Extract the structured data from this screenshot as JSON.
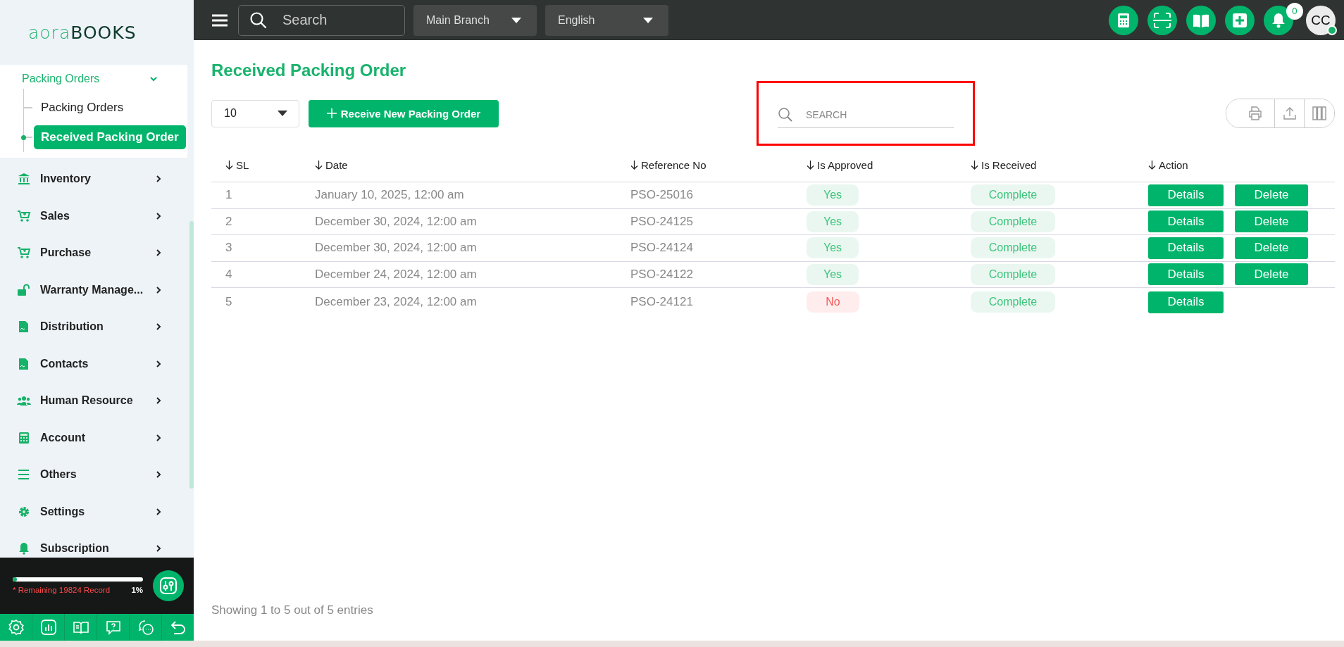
{
  "sidebar": {
    "logo": {
      "part_1": "aora",
      "part_2": "BOOKS"
    },
    "open_group": {
      "label": "Packing Orders",
      "expanded": true,
      "children": [
        {
          "label": "Packing Orders",
          "selected": false
        },
        {
          "label": "Received Packing Order",
          "selected": true
        }
      ]
    },
    "items": [
      {
        "label": "Inventory"
      },
      {
        "label": "Sales"
      },
      {
        "label": "Purchase"
      },
      {
        "label": "Warranty Manage..."
      },
      {
        "label": "Distribution"
      },
      {
        "label": "Contacts"
      },
      {
        "label": "Human Resource"
      },
      {
        "label": "Account"
      },
      {
        "label": "Others"
      },
      {
        "label": "Settings"
      },
      {
        "label": "Subscription"
      }
    ],
    "usage": {
      "level": 0.01,
      "text": "* Remaining 19824 Record",
      "percent": "1%"
    }
  },
  "topbar": {
    "search": {
      "placeholder": "Search"
    },
    "branch": "Main Branch",
    "language": "English",
    "notification_count": "0",
    "avatar": "CC",
    "online": true
  },
  "page": {
    "title": "Received Packing Order",
    "page_size": "10",
    "new_button": "Receive New Packing Order",
    "search": {
      "placeholder": "SEARCH"
    }
  },
  "table": {
    "columns": [
      "SL",
      "Date",
      "Reference No",
      "Is Approved",
      "Is Received",
      "Action"
    ],
    "rows": [
      {
        "sl": "1",
        "date": "January 10, 2025, 12:00 am",
        "reference": "PSO-25016",
        "is_approved": "Yes",
        "approved": true,
        "is_received": "Complete",
        "actions": [
          "Details",
          "Delete"
        ]
      },
      {
        "sl": "2",
        "date": "December 30, 2024, 12:00 am",
        "reference": "PSO-24125",
        "is_approved": "Yes",
        "approved": true,
        "is_received": "Complete",
        "actions": [
          "Details",
          "Delete"
        ]
      },
      {
        "sl": "3",
        "date": "December 30, 2024, 12:00 am",
        "reference": "PSO-24124",
        "is_approved": "Yes",
        "approved": true,
        "is_received": "Complete",
        "actions": [
          "Details",
          "Delete"
        ]
      },
      {
        "sl": "4",
        "date": "December 24, 2024, 12:00 am",
        "reference": "PSO-24122",
        "is_approved": "Yes",
        "approved": true,
        "is_received": "Complete",
        "actions": [
          "Details",
          "Delete"
        ]
      },
      {
        "sl": "5",
        "date": "December 23, 2024, 12:00 am",
        "reference": "PSO-24121",
        "is_approved": "No",
        "approved": false,
        "is_received": "Complete",
        "actions": [
          "Details"
        ]
      }
    ]
  },
  "footer": "Showing 1 to 5 out of 5 entries"
}
